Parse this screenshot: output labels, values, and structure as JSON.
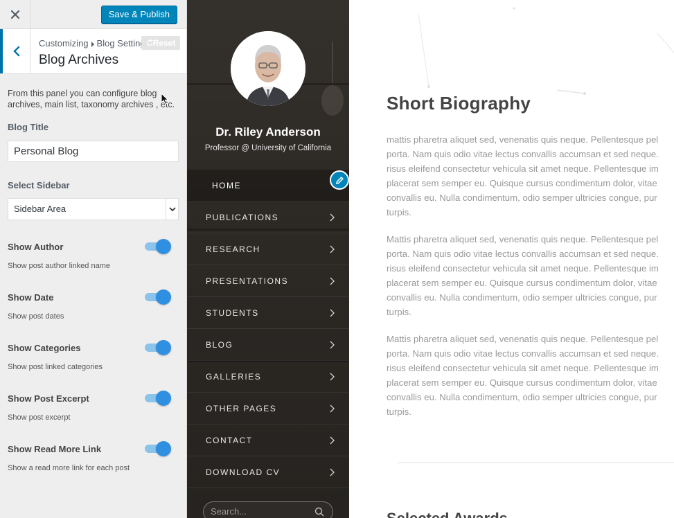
{
  "customizer": {
    "header": {
      "close_icon": "close-icon",
      "save_label": "Save & Publish"
    },
    "section": {
      "breadcrumb_parent": "Customizing",
      "breadcrumb_child": "Blog Settings",
      "reset_label": "Reset",
      "title": "Blog Archives",
      "back_icon": "chevron-left-icon"
    },
    "description": "From this panel you can configure blog archives, main list, taxonomy archives , etc.",
    "blog_title": {
      "label": "Blog Title",
      "value": "Personal Blog"
    },
    "sidebar_select": {
      "label": "Select Sidebar",
      "value": "Sidebar Area"
    },
    "toggles": [
      {
        "label": "Show Author",
        "desc": "Show post author linked name",
        "on": true
      },
      {
        "label": "Show Date",
        "desc": "Show post dates",
        "on": true
      },
      {
        "label": "Show Categories",
        "desc": "Show post linked categories",
        "on": true
      },
      {
        "label": "Show Post Excerpt",
        "desc": "Show post excerpt",
        "on": true
      },
      {
        "label": "Show Read More Link",
        "desc": "Show a read more link for each post",
        "on": true
      }
    ],
    "accent": "#0085ba"
  },
  "site": {
    "profile": {
      "name": "Dr. Riley Anderson",
      "role": "Professor @ University of California"
    },
    "nav": [
      {
        "label": "HOME",
        "active": true
      },
      {
        "label": "PUBLICATIONS"
      },
      {
        "label": "RESEARCH"
      },
      {
        "label": "PRESENTATIONS"
      },
      {
        "label": "STUDENTS"
      },
      {
        "label": "BLOG"
      },
      {
        "label": "GALLERIES"
      },
      {
        "label": "OTHER PAGES"
      },
      {
        "label": "CONTACT"
      },
      {
        "label": "DOWNLOAD CV"
      }
    ],
    "search_placeholder": "Search..."
  },
  "main": {
    "heading": "Short Biography",
    "paragraphs": [
      [
        "mattis pharetra aliquet sed, venenatis quis neque. Pellentesque pel",
        "porta. Nam quis odio vitae lectus convallis accumsan et sed neque.",
        "risus eleifend consectetur vehicula sit amet neque. Pellentesque im",
        "placerat sem semper eu. Quisque cursus condimentum dolor, vitae",
        "convallis eu. Nulla condimentum, odio semper ultricies congue, pur",
        "turpis."
      ],
      [
        "Mattis pharetra aliquet sed, venenatis quis neque. Pellentesque pel",
        "porta. Nam quis odio vitae lectus convallis accumsan et sed neque.",
        "risus eleifend consectetur vehicula sit amet neque. Pellentesque im",
        "placerat sem semper eu. Quisque cursus condimentum dolor, vitae",
        "convallis eu. Nulla condimentum, odio semper ultricies congue, pur",
        "turpis."
      ],
      [
        "Mattis pharetra aliquet sed, venenatis quis neque. Pellentesque pel",
        "porta. Nam quis odio vitae lectus convallis accumsan et sed neque.",
        "risus eleifend consectetur vehicula sit amet neque. Pellentesque im",
        "placerat sem semper eu. Quisque cursus condimentum dolor, vitae",
        "convallis eu. Nulla condimentum, odio semper ultricies congue, pur",
        "turpis."
      ]
    ],
    "next_heading": "Selected Awards"
  }
}
